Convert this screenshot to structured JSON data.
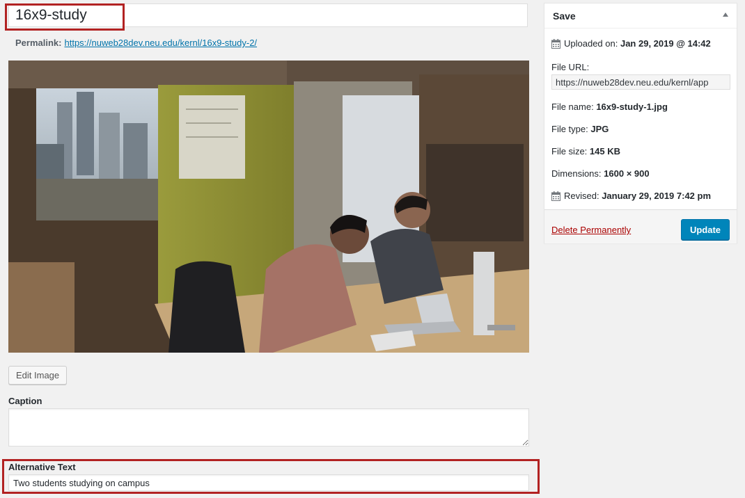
{
  "title": {
    "value": "16x9-study"
  },
  "permalink": {
    "label": "Permalink:",
    "url": "https://nuweb28dev.neu.edu/kernl/16x9-study-2/"
  },
  "image": {
    "alt": "Two students studying on campus"
  },
  "edit_image_label": "Edit Image",
  "caption": {
    "label": "Caption",
    "value": ""
  },
  "alt_text": {
    "label": "Alternative Text",
    "value": "Two students studying on campus"
  },
  "save_box": {
    "title": "Save",
    "uploaded_label": "Uploaded on:",
    "uploaded_value": "Jan 29, 2019 @ 14:42",
    "file_url_label": "File URL:",
    "file_url_value": "https://nuweb28dev.neu.edu/kernl/app",
    "file_name_label": "File name:",
    "file_name_value": "16x9-study-1.jpg",
    "file_type_label": "File type:",
    "file_type_value": "JPG",
    "file_size_label": "File size:",
    "file_size_value": "145 KB",
    "dimensions_label": "Dimensions:",
    "dimensions_value": "1600 × 900",
    "revised_label": "Revised:",
    "revised_value": "January 29, 2019 7:42 pm",
    "delete_label": "Delete Permanently",
    "update_label": "Update"
  },
  "colors": {
    "highlight": "#b22222",
    "primary": "#0085ba",
    "delete": "#aa0000",
    "link": "#0073aa"
  }
}
